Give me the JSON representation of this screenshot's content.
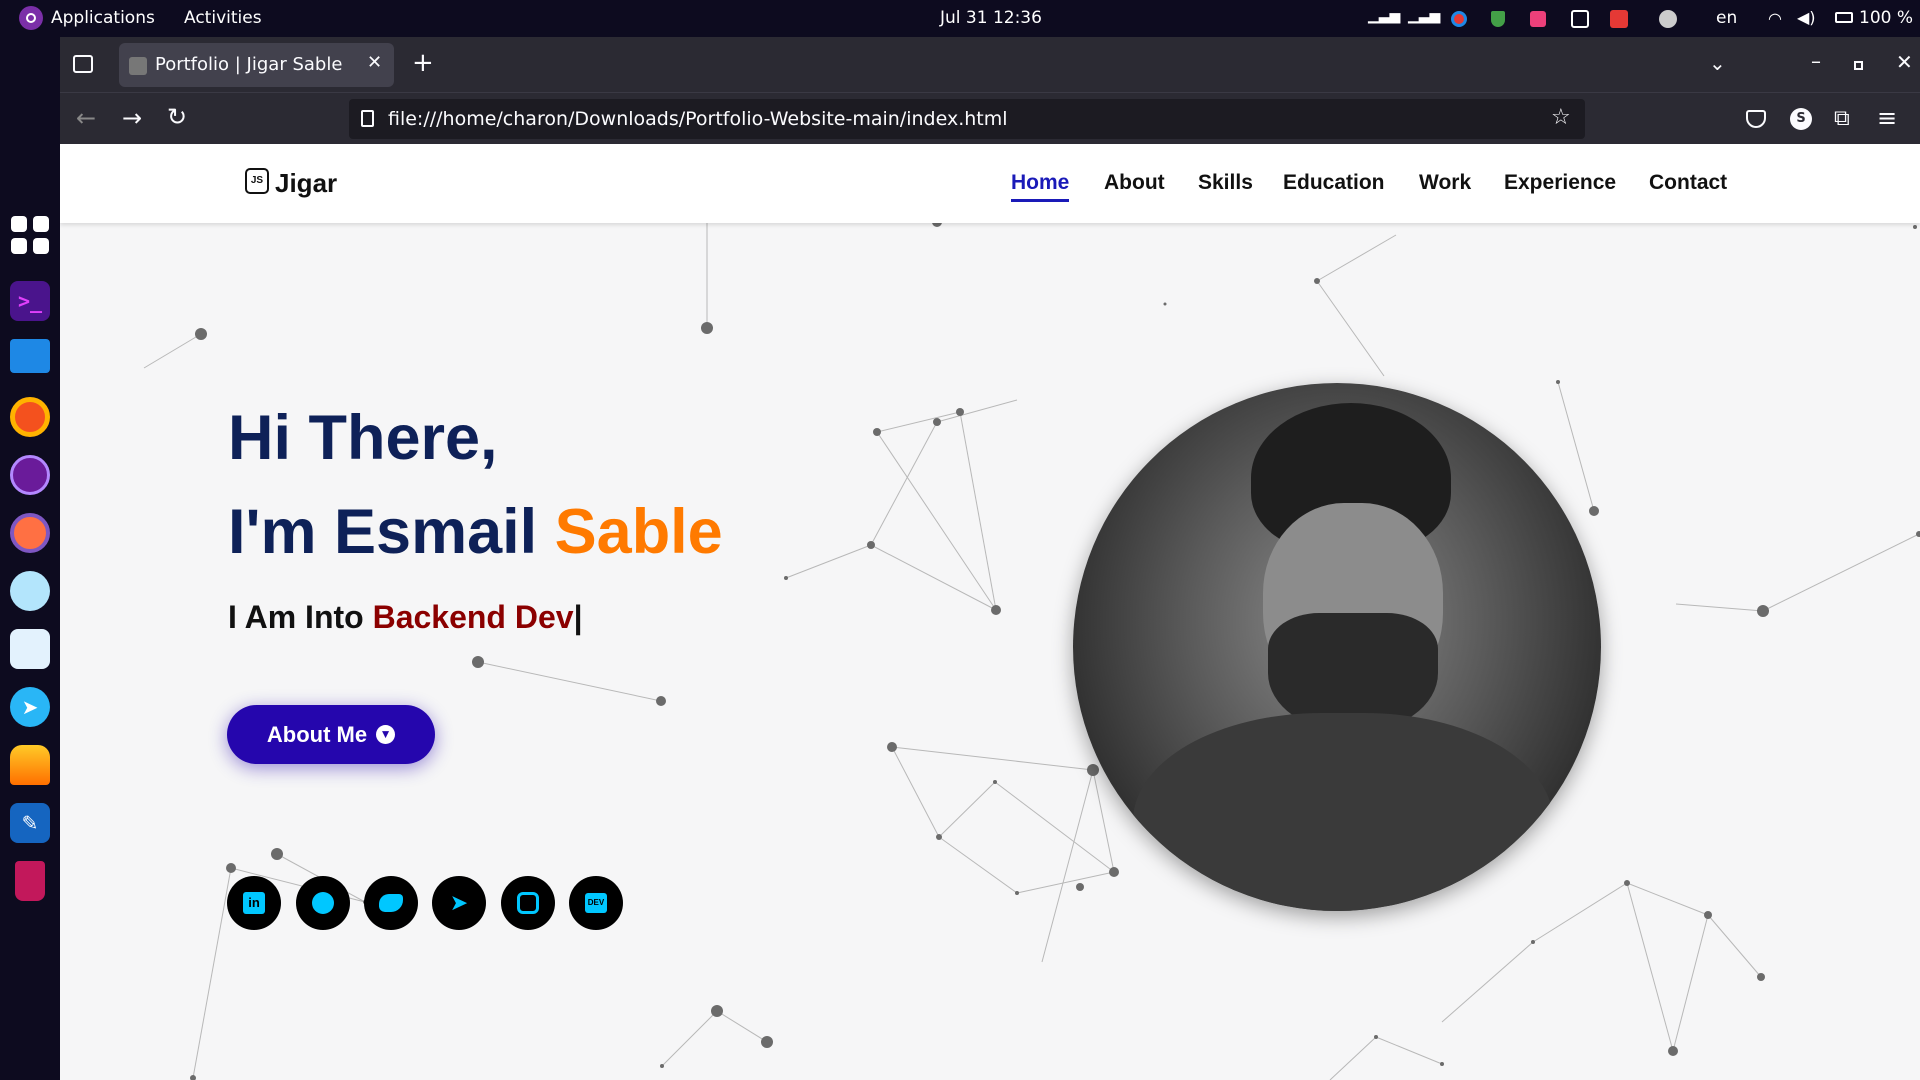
{
  "topbar": {
    "applications": "Applications",
    "activities": "Activities",
    "clock": "Jul 31  12:36",
    "language": "en",
    "battery": "100 %"
  },
  "browser": {
    "tab_title": "Portfolio | Jigar Sable",
    "url": "file:///home/charon/Downloads/Portfolio-Website-main/index.html",
    "profile_initial": "S"
  },
  "site": {
    "logo_text": "Jigar",
    "logo_badge": "JS",
    "nav": {
      "home": "Home",
      "about": "About",
      "skills": "Skills",
      "education": "Education",
      "work": "Work",
      "experience": "Experience",
      "contact": "Contact"
    },
    "hero": {
      "greeting": "Hi There,",
      "name_prefix": "I'm Esmail ",
      "name_highlight": "Sable",
      "into_prefix": "I Am Into ",
      "into_role": "Backend Dev",
      "cursor": "|",
      "about_button": "About Me"
    },
    "social_dev_label": "DEV"
  },
  "colors": {
    "heading": "#0e2158",
    "accent_orange": "#ff7a00",
    "role_red": "#8b0000",
    "button": "#2506ad",
    "nav_active": "#1a1ab8",
    "social_icon": "#00c7ff"
  }
}
